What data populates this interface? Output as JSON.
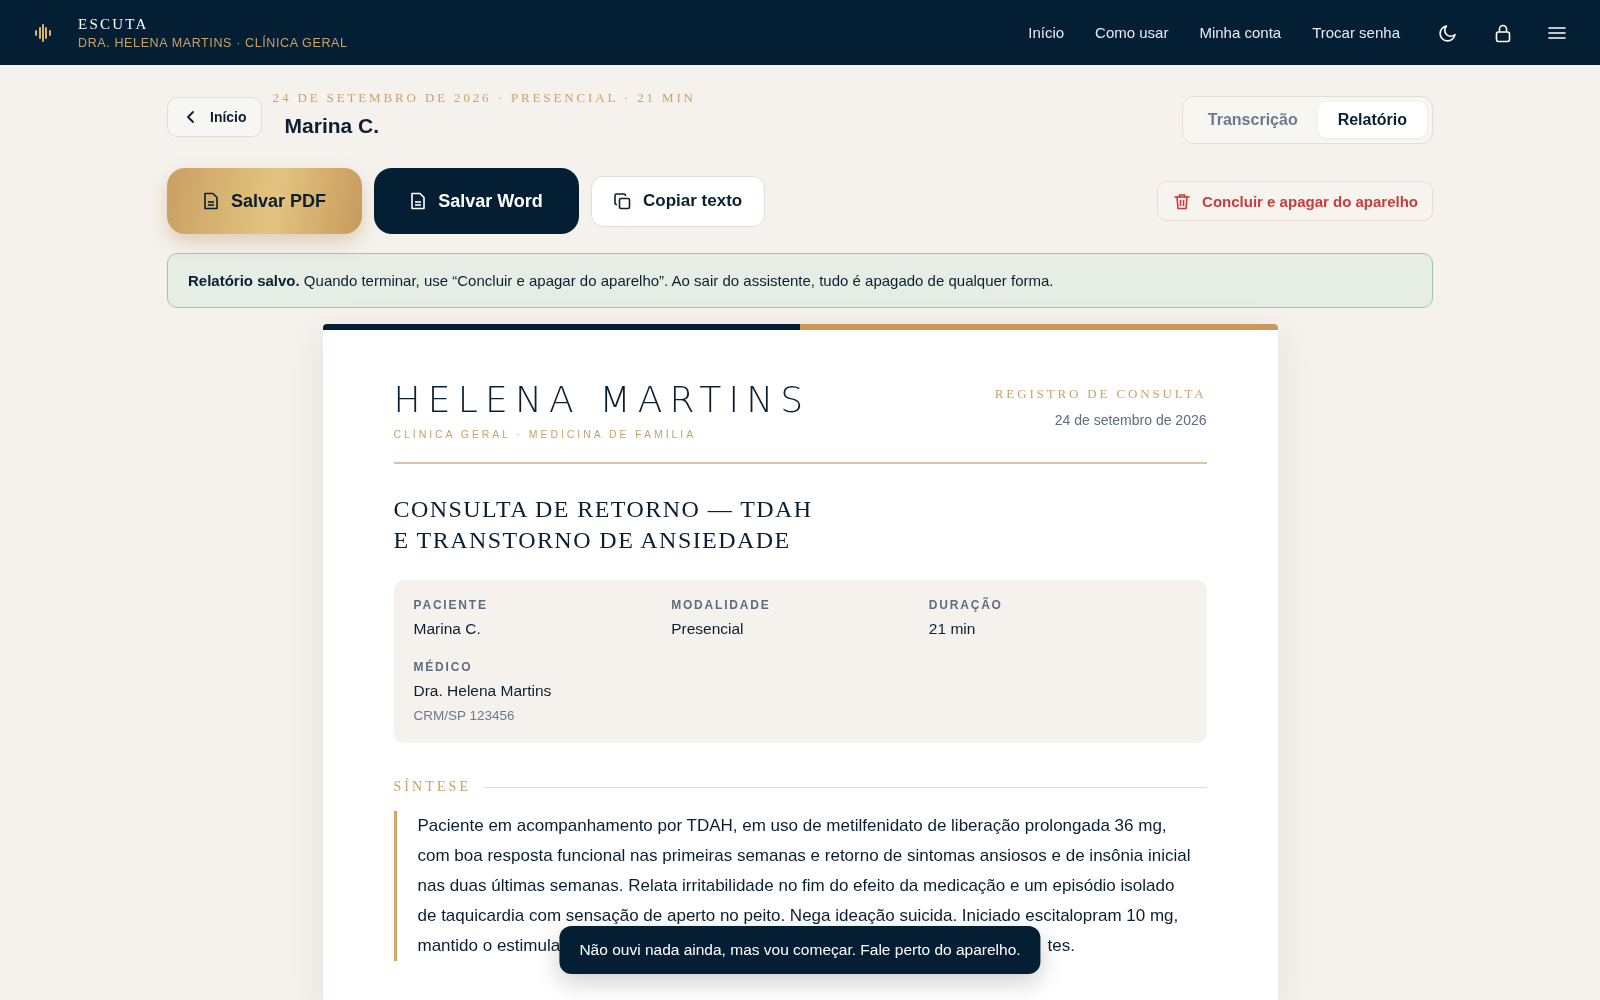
{
  "topbar": {
    "brand": "ESCUTA",
    "subtitle": "DRA. HELENA MARTINS · CLÍNICA GERAL",
    "nav": [
      "Início",
      "Como usar",
      "Minha conta",
      "Trocar senha"
    ]
  },
  "header": {
    "back": "Início",
    "meta": "24 DE SETEMBRO DE 2026 · PRESENCIAL · 21 MIN",
    "patient": "Marina C.",
    "tabs": [
      {
        "label": "Transcrição",
        "selected": false
      },
      {
        "label": "Relatório",
        "selected": true
      }
    ]
  },
  "actions": [
    {
      "kind": "gold",
      "label": "Salvar PDF"
    },
    {
      "kind": "dark",
      "label": "Salvar Word"
    },
    {
      "kind": "plain",
      "label": "Copiar texto"
    }
  ],
  "danger_action": "Concluir e apagar do aparelho",
  "notice": "**Relatório salvo.** Quando terminar, use “Concluir e apagar do aparelho”. Ao sair do assistente, tudo é apagado de qualquer forma.",
  "document": {
    "doctor": "HELENA MARTINS",
    "specialty": "CLÍNICA GERAL · MEDICINA DE FAMÍLIA",
    "record_label": "REGISTRO DE CONSULTA",
    "date": "24 de setembro de 2026",
    "title_lines": [
      "CONSULTA DE RETORNO — TDAH",
      "E TRANSTORNO DE ANSIEDADE"
    ],
    "fields": [
      {
        "label": "PACIENTE",
        "value": "Marina C."
      },
      {
        "label": "MODALIDADE",
        "value": "Presencial"
      },
      {
        "label": "DURAÇÃO",
        "value": "21 min"
      },
      {
        "label": "MÉDICO",
        "value": "Dra. Helena Martins",
        "note": "CRM/SP 123456"
      }
    ],
    "section": "SÍNTESE",
    "summary_lines": [
      "Paciente em acompanhamento por TDAH, em uso de metilfenidato de liberação prolongada 36 mg,",
      "com boa resposta funcional nas primeiras semanas e retorno de sintomas ansiosos e de insônia inicial",
      "nas duas últimas semanas. Relata irritabilidade no fim do efeito da medicação e um episódio isolado",
      "de taquicardia com sensação de aperto no peito. Nega ideação suicida. Iniciado escitalopram 10 mg,"
    ],
    "summary_cut_start": "mantido o estimula",
    "summary_cut_end": "tes."
  },
  "toast": "Não ouvi nada ainda, mas vou começar. Fale perto do aparelho."
}
